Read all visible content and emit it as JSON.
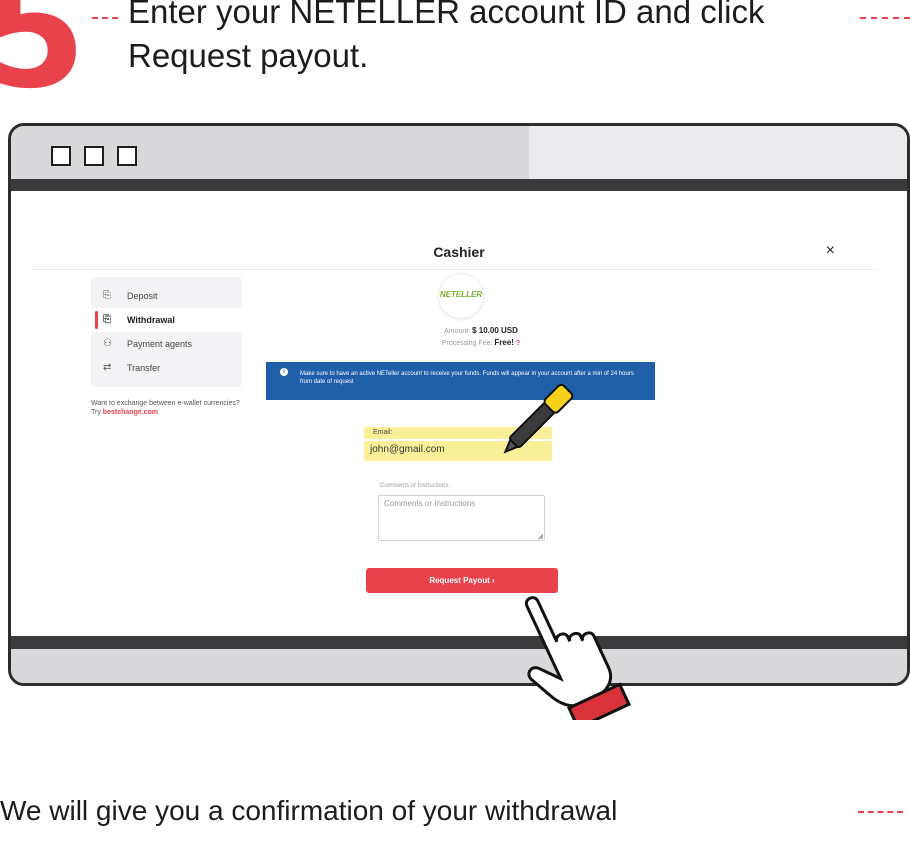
{
  "header": {
    "step_number": "5",
    "instruction_line1": "Enter your  NETELLER account ID and click",
    "instruction_line2": "Request payout."
  },
  "cashier": {
    "title": "Cashier",
    "close_glyph": "×",
    "nav": [
      {
        "label": "Deposit",
        "icon": "wallet-icon"
      },
      {
        "label": "Withdrawal",
        "icon": "wallet-icon",
        "active": true
      },
      {
        "label": "Payment agents",
        "icon": "agent-icon"
      },
      {
        "label": "Transfer",
        "icon": "transfer-icon"
      }
    ],
    "exchange_text": "Want to exchange between e-wallet currencies? Try ",
    "exchange_link": "bestchange.com",
    "logo_text": "NETELLER",
    "amount_label": "Amount:",
    "amount_value": "$ 10.00 USD",
    "fee_label": "Processing Fee:",
    "fee_value": "Free!",
    "fee_help": "?",
    "info_text": "Make sure to have an active NETeller account to receive your funds. Funds will appear in your account after a min of 24 hours from date of request",
    "email_label": "Email:",
    "email_value": "john@gmail.com",
    "comments_label": "Comments or Instructions:",
    "comments_placeholder": "Comments or Instructions",
    "button_label": "Request Payout",
    "button_chevron": "›"
  },
  "footer_text": "We will give you a confirmation of your withdrawal",
  "colors": {
    "accent": "#e8424d",
    "info_blue": "#1f5ea8",
    "highlight": "#fbf09a",
    "neteller_green": "#7ab32e"
  }
}
